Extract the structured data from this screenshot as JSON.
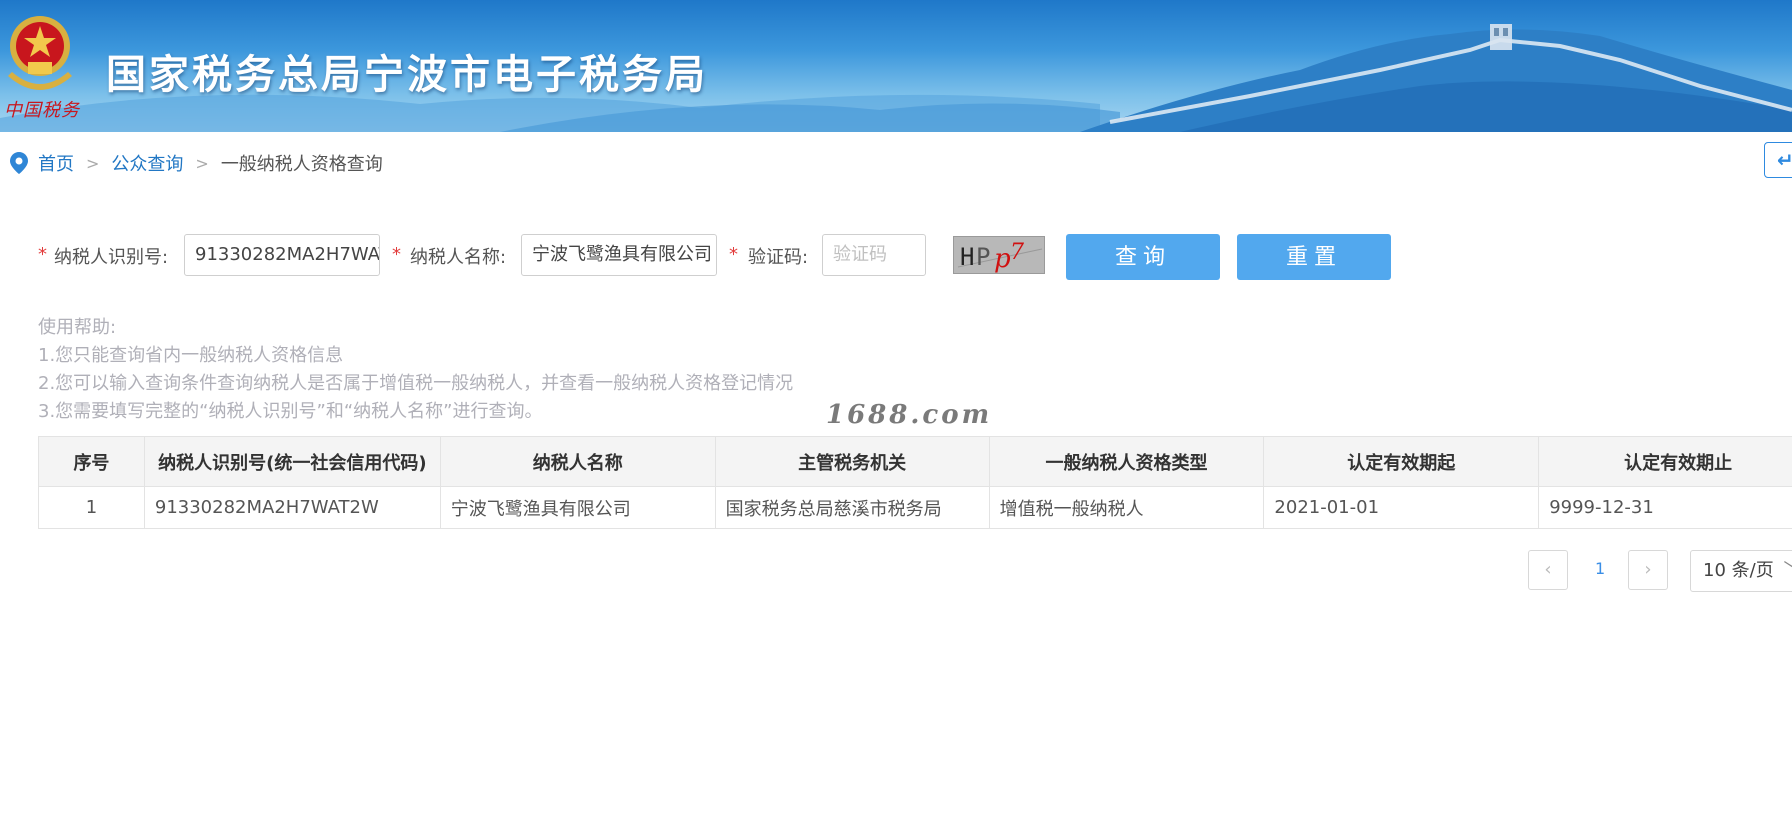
{
  "header": {
    "title": "国家税务总局宁波市电子税务局",
    "emblem_caption": "中国税务",
    "colors": {
      "banner_top": "#1f78c9",
      "banner_bottom": "#a9d6f1",
      "emblem_red": "#c8161d"
    }
  },
  "breadcrumb": {
    "items": [
      "首页",
      "公众查询"
    ],
    "current": "一般纳税人资格查询",
    "separator": ">"
  },
  "form": {
    "taxpayer_id_label": "纳税人识别号:",
    "taxpayer_id_value": "91330282MA2H7WAT2W",
    "taxpayer_name_label": "纳税人名称:",
    "taxpayer_name_value": "宁波飞鹭渔具有限公司",
    "captcha_label": "验证码:",
    "captcha_placeholder": "验证码",
    "required_mark": "*",
    "captcha_text": "HPp7",
    "query_button": "查询",
    "reset_button": "重置",
    "button_color": "#52a8ee"
  },
  "help": {
    "title": "使用帮助:",
    "lines": [
      "1.您只能查询省内一般纳税人资格信息",
      "2.您可以输入查询条件查询纳税人是否属于增值税一般纳税人，并查看一般纳税人资格登记情况",
      "3.您需要填写完整的“纳税人识别号”和“纳税人名称”进行查询。"
    ]
  },
  "watermark": "1688.com",
  "table": {
    "headers": [
      "序号",
      "纳税人识别号(统一社会信用代码)",
      "纳税人名称",
      "主管税务机关",
      "一般纳税人资格类型",
      "认定有效期起",
      "认定有效期止"
    ],
    "rows": [
      [
        "1",
        "91330282MA2H7WAT2W",
        "宁波飞鹭渔具有限公司",
        "国家税务总局慈溪市税务局",
        "增值税一般纳税人",
        "2021-01-01",
        "9999-12-31"
      ]
    ]
  },
  "pagination": {
    "prev_icon": "chevron-left-icon",
    "next_icon": "chevron-right-icon",
    "current_page": "1",
    "page_size": "10 条/页"
  }
}
